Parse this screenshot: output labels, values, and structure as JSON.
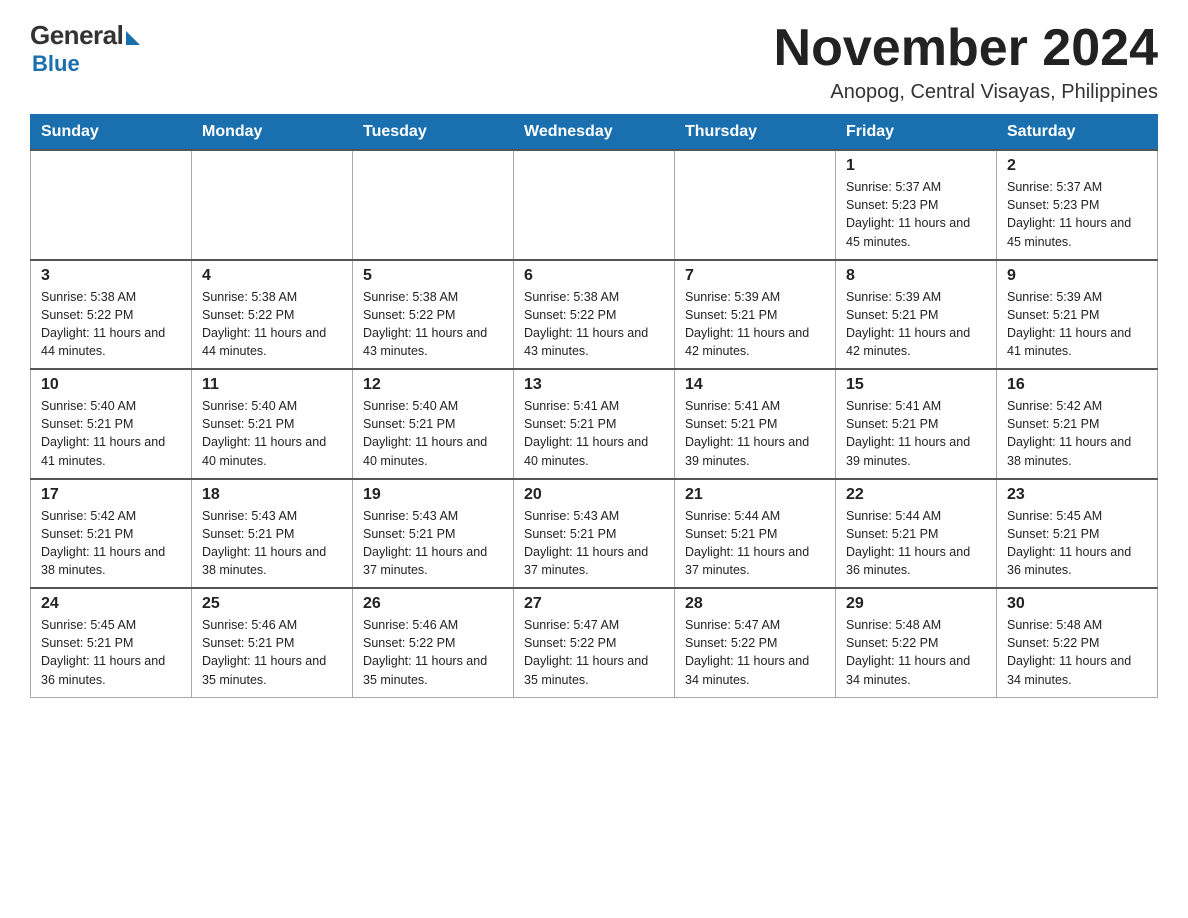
{
  "logo": {
    "general": "General",
    "blue": "Blue"
  },
  "title": {
    "month_year": "November 2024",
    "location": "Anopog, Central Visayas, Philippines"
  },
  "weekdays": [
    "Sunday",
    "Monday",
    "Tuesday",
    "Wednesday",
    "Thursday",
    "Friday",
    "Saturday"
  ],
  "weeks": [
    [
      {
        "day": "",
        "sunrise": "",
        "sunset": "",
        "daylight": ""
      },
      {
        "day": "",
        "sunrise": "",
        "sunset": "",
        "daylight": ""
      },
      {
        "day": "",
        "sunrise": "",
        "sunset": "",
        "daylight": ""
      },
      {
        "day": "",
        "sunrise": "",
        "sunset": "",
        "daylight": ""
      },
      {
        "day": "",
        "sunrise": "",
        "sunset": "",
        "daylight": ""
      },
      {
        "day": "1",
        "sunrise": "Sunrise: 5:37 AM",
        "sunset": "Sunset: 5:23 PM",
        "daylight": "Daylight: 11 hours and 45 minutes."
      },
      {
        "day": "2",
        "sunrise": "Sunrise: 5:37 AM",
        "sunset": "Sunset: 5:23 PM",
        "daylight": "Daylight: 11 hours and 45 minutes."
      }
    ],
    [
      {
        "day": "3",
        "sunrise": "Sunrise: 5:38 AM",
        "sunset": "Sunset: 5:22 PM",
        "daylight": "Daylight: 11 hours and 44 minutes."
      },
      {
        "day": "4",
        "sunrise": "Sunrise: 5:38 AM",
        "sunset": "Sunset: 5:22 PM",
        "daylight": "Daylight: 11 hours and 44 minutes."
      },
      {
        "day": "5",
        "sunrise": "Sunrise: 5:38 AM",
        "sunset": "Sunset: 5:22 PM",
        "daylight": "Daylight: 11 hours and 43 minutes."
      },
      {
        "day": "6",
        "sunrise": "Sunrise: 5:38 AM",
        "sunset": "Sunset: 5:22 PM",
        "daylight": "Daylight: 11 hours and 43 minutes."
      },
      {
        "day": "7",
        "sunrise": "Sunrise: 5:39 AM",
        "sunset": "Sunset: 5:21 PM",
        "daylight": "Daylight: 11 hours and 42 minutes."
      },
      {
        "day": "8",
        "sunrise": "Sunrise: 5:39 AM",
        "sunset": "Sunset: 5:21 PM",
        "daylight": "Daylight: 11 hours and 42 minutes."
      },
      {
        "day": "9",
        "sunrise": "Sunrise: 5:39 AM",
        "sunset": "Sunset: 5:21 PM",
        "daylight": "Daylight: 11 hours and 41 minutes."
      }
    ],
    [
      {
        "day": "10",
        "sunrise": "Sunrise: 5:40 AM",
        "sunset": "Sunset: 5:21 PM",
        "daylight": "Daylight: 11 hours and 41 minutes."
      },
      {
        "day": "11",
        "sunrise": "Sunrise: 5:40 AM",
        "sunset": "Sunset: 5:21 PM",
        "daylight": "Daylight: 11 hours and 40 minutes."
      },
      {
        "day": "12",
        "sunrise": "Sunrise: 5:40 AM",
        "sunset": "Sunset: 5:21 PM",
        "daylight": "Daylight: 11 hours and 40 minutes."
      },
      {
        "day": "13",
        "sunrise": "Sunrise: 5:41 AM",
        "sunset": "Sunset: 5:21 PM",
        "daylight": "Daylight: 11 hours and 40 minutes."
      },
      {
        "day": "14",
        "sunrise": "Sunrise: 5:41 AM",
        "sunset": "Sunset: 5:21 PM",
        "daylight": "Daylight: 11 hours and 39 minutes."
      },
      {
        "day": "15",
        "sunrise": "Sunrise: 5:41 AM",
        "sunset": "Sunset: 5:21 PM",
        "daylight": "Daylight: 11 hours and 39 minutes."
      },
      {
        "day": "16",
        "sunrise": "Sunrise: 5:42 AM",
        "sunset": "Sunset: 5:21 PM",
        "daylight": "Daylight: 11 hours and 38 minutes."
      }
    ],
    [
      {
        "day": "17",
        "sunrise": "Sunrise: 5:42 AM",
        "sunset": "Sunset: 5:21 PM",
        "daylight": "Daylight: 11 hours and 38 minutes."
      },
      {
        "day": "18",
        "sunrise": "Sunrise: 5:43 AM",
        "sunset": "Sunset: 5:21 PM",
        "daylight": "Daylight: 11 hours and 38 minutes."
      },
      {
        "day": "19",
        "sunrise": "Sunrise: 5:43 AM",
        "sunset": "Sunset: 5:21 PM",
        "daylight": "Daylight: 11 hours and 37 minutes."
      },
      {
        "day": "20",
        "sunrise": "Sunrise: 5:43 AM",
        "sunset": "Sunset: 5:21 PM",
        "daylight": "Daylight: 11 hours and 37 minutes."
      },
      {
        "day": "21",
        "sunrise": "Sunrise: 5:44 AM",
        "sunset": "Sunset: 5:21 PM",
        "daylight": "Daylight: 11 hours and 37 minutes."
      },
      {
        "day": "22",
        "sunrise": "Sunrise: 5:44 AM",
        "sunset": "Sunset: 5:21 PM",
        "daylight": "Daylight: 11 hours and 36 minutes."
      },
      {
        "day": "23",
        "sunrise": "Sunrise: 5:45 AM",
        "sunset": "Sunset: 5:21 PM",
        "daylight": "Daylight: 11 hours and 36 minutes."
      }
    ],
    [
      {
        "day": "24",
        "sunrise": "Sunrise: 5:45 AM",
        "sunset": "Sunset: 5:21 PM",
        "daylight": "Daylight: 11 hours and 36 minutes."
      },
      {
        "day": "25",
        "sunrise": "Sunrise: 5:46 AM",
        "sunset": "Sunset: 5:21 PM",
        "daylight": "Daylight: 11 hours and 35 minutes."
      },
      {
        "day": "26",
        "sunrise": "Sunrise: 5:46 AM",
        "sunset": "Sunset: 5:22 PM",
        "daylight": "Daylight: 11 hours and 35 minutes."
      },
      {
        "day": "27",
        "sunrise": "Sunrise: 5:47 AM",
        "sunset": "Sunset: 5:22 PM",
        "daylight": "Daylight: 11 hours and 35 minutes."
      },
      {
        "day": "28",
        "sunrise": "Sunrise: 5:47 AM",
        "sunset": "Sunset: 5:22 PM",
        "daylight": "Daylight: 11 hours and 34 minutes."
      },
      {
        "day": "29",
        "sunrise": "Sunrise: 5:48 AM",
        "sunset": "Sunset: 5:22 PM",
        "daylight": "Daylight: 11 hours and 34 minutes."
      },
      {
        "day": "30",
        "sunrise": "Sunrise: 5:48 AM",
        "sunset": "Sunset: 5:22 PM",
        "daylight": "Daylight: 11 hours and 34 minutes."
      }
    ]
  ]
}
